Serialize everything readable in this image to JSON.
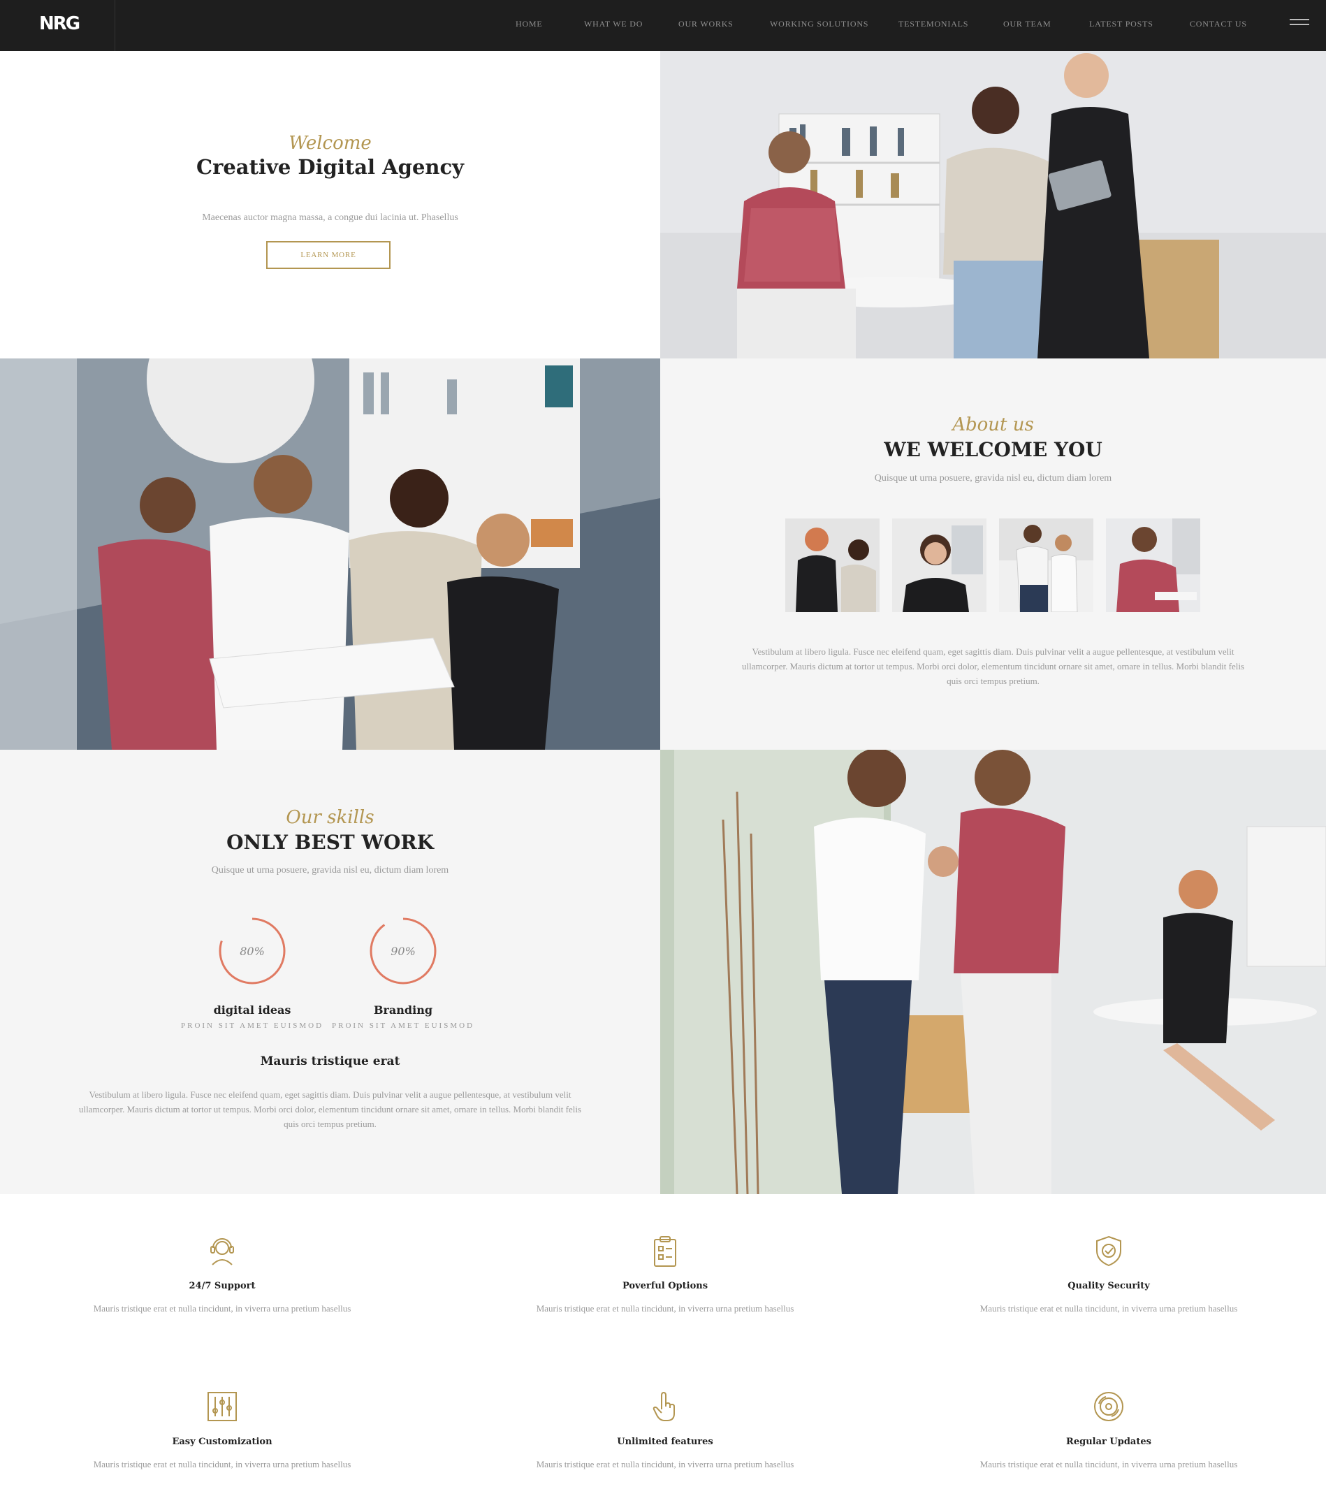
{
  "brand": {
    "logo": "NRG"
  },
  "nav": {
    "items": [
      "HOME",
      "WHAT WE DO",
      "OUR WORKS",
      "WORKING SOLUTIONS",
      "TESTEMONIALS",
      "OUR TEAM",
      "LATEST POSTS",
      "CONTACT US"
    ]
  },
  "hero": {
    "script": "Welcome",
    "title": "Creative Digital Agency",
    "text": "Maecenas auctor magna massa, a congue dui lacinia ut. Phasellus",
    "button": "LEARN MORE"
  },
  "about": {
    "script": "About us",
    "title": "WE WELCOME YOU",
    "subtitle": "Quisque ut urna posuere, gravida nisl eu, dictum diam lorem",
    "paragraph_lines": [
      "Vestibulum at libero ligula. Fusce nec eleifend quam, eget sagittis diam. Duis pulvinar velit a augue pellentesque, at vestibulum velit",
      "ullamcorper. Mauris dictum at tortor ut tempus. Morbi orci dolor, elementum tincidunt ornare sit amet, ornare in tellus. Morbi blandit felis",
      "quis orci tempus pretium."
    ]
  },
  "skills": {
    "script": "Our skills",
    "title": "ONLY BEST WORK",
    "subtitle": "Quisque ut urna posuere, gravida nisl eu, dictum diam lorem",
    "items": [
      {
        "percent": "80%",
        "value": 0.8,
        "name": "digital ideas",
        "sub": "PROIN SIT AMET EUISMOD"
      },
      {
        "percent": "90%",
        "value": 0.9,
        "name": "Branding",
        "sub": "PROIN SIT AMET EUISMOD"
      }
    ],
    "subheading": "Mauris tristique erat",
    "paragraph_lines": [
      "Vestibulum at libero ligula. Fusce nec eleifend quam, eget sagittis diam. Duis pulvinar velit a augue pellentesque, at vestibulum velit",
      "ullamcorper. Mauris dictum at tortor ut tempus. Morbi orci dolor, elementum tincidunt ornare sit amet, ornare in tellus. Morbi blandit felis",
      "quis orci tempus pretium."
    ]
  },
  "features": [
    {
      "icon": "headset-icon",
      "title": "24/7 Support",
      "desc": "Mauris tristique erat et nulla tincidunt, in viverra urna pretium hasellus"
    },
    {
      "icon": "clipboard-icon",
      "title": "Poverful Options",
      "desc": "Mauris tristique erat et nulla tincidunt, in viverra urna pretium hasellus"
    },
    {
      "icon": "shield-check-icon",
      "title": "Quality Security",
      "desc": "Mauris tristique erat et nulla tincidunt, in viverra urna pretium hasellus"
    },
    {
      "icon": "sliders-icon",
      "title": "Easy Customization",
      "desc": "Mauris tristique erat et nulla tincidunt, in viverra urna pretium hasellus"
    },
    {
      "icon": "pointer-hand-icon",
      "title": "Unlimited features",
      "desc": "Mauris tristique erat et nulla tincidunt, in viverra urna pretium hasellus"
    },
    {
      "icon": "update-disc-icon",
      "title": "Regular Updates",
      "desc": "Mauris tristique erat et nulla tincidunt, in viverra urna pretium hasellus"
    }
  ],
  "colors": {
    "accent_gold": "#b39651",
    "ring": "#e07a62",
    "nav_bg": "#1e1e1e",
    "panel_gray": "#f5f5f5"
  }
}
